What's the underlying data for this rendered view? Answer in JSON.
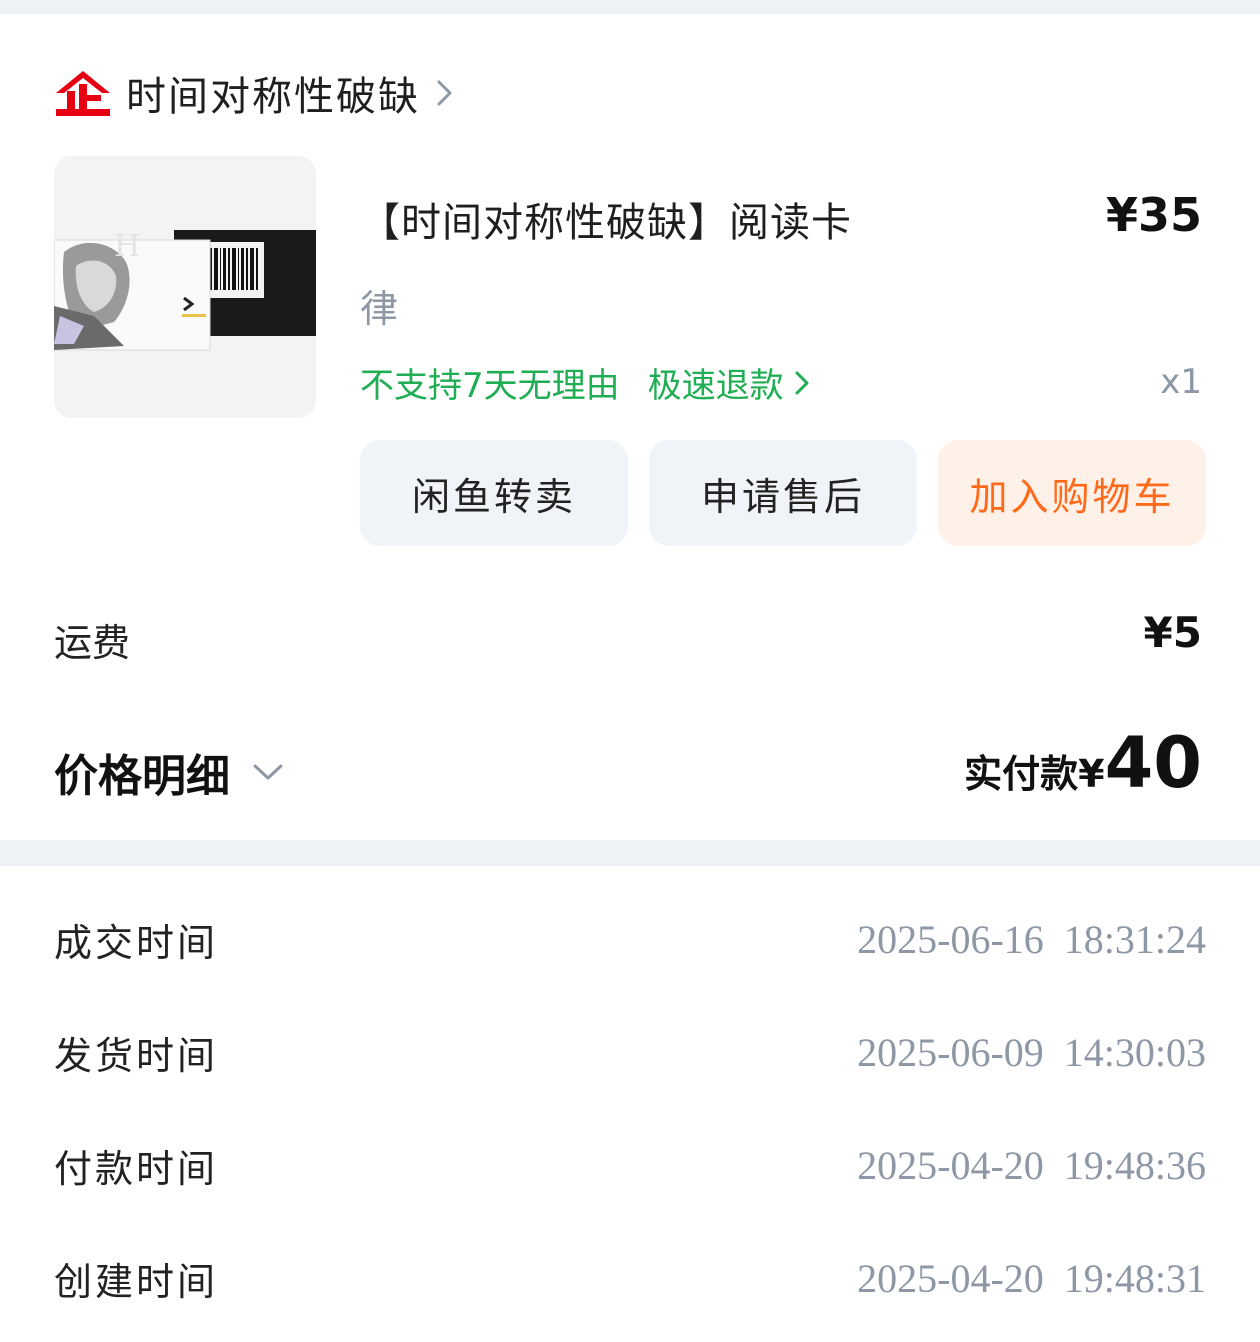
{
  "shop": {
    "name": "时间对称性破缺",
    "logo_icon": "enterprise-shop-icon"
  },
  "product": {
    "title": "【时间对称性破缺】阅读卡",
    "price": "¥35",
    "spec": "律",
    "refund_policy": "不支持7天无理由",
    "fast_refund": "极速退款",
    "quantity": "x1"
  },
  "actions": {
    "resell": "闲鱼转卖",
    "after_sale": "申请售后",
    "add_cart": "加入购物车"
  },
  "shipping": {
    "label": "运费",
    "value": "¥5"
  },
  "price_detail": {
    "label": "价格明细",
    "paid_label": "实付款¥",
    "paid_amount": "40"
  },
  "times": [
    {
      "label": "成交时间",
      "value": "2025-06-16  18:31:24"
    },
    {
      "label": "发货时间",
      "value": "2025-06-09  14:30:03"
    },
    {
      "label": "付款时间",
      "value": "2025-04-20  19:48:36"
    },
    {
      "label": "创建时间",
      "value": "2025-04-20  19:48:31"
    }
  ],
  "colors": {
    "accent_orange": "#ff6a1a",
    "green": "#1fae53",
    "shop_logo_red": "#e60012",
    "muted_gray": "#8d97a6"
  }
}
